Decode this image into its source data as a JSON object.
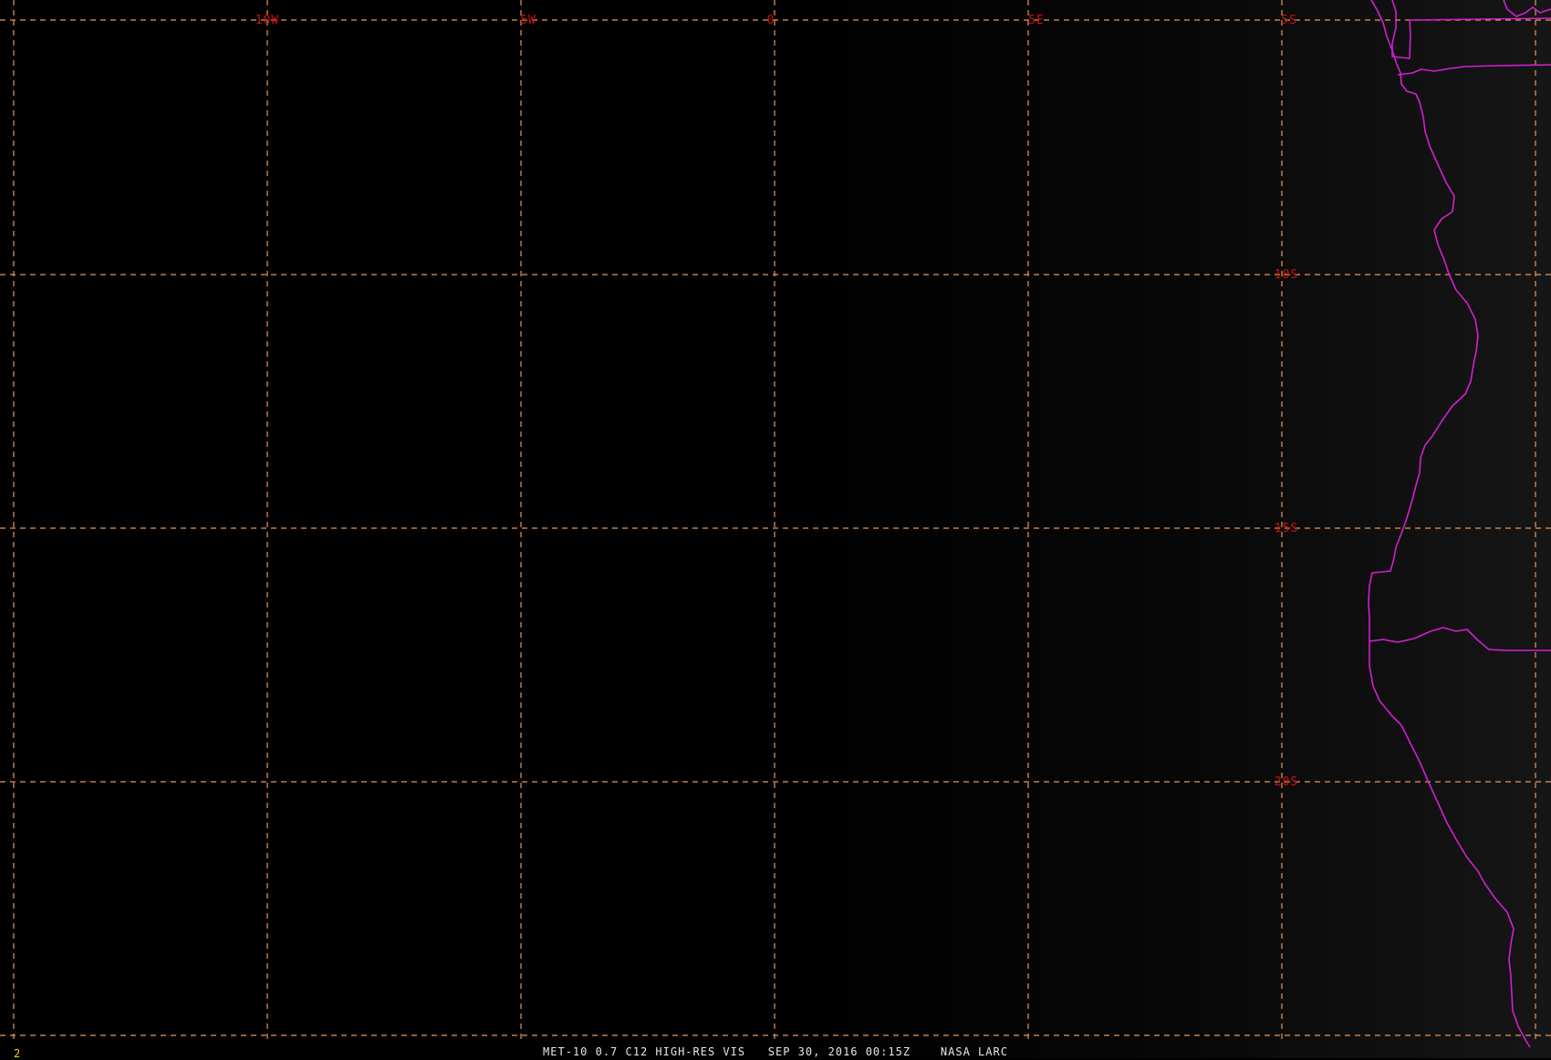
{
  "map": {
    "background_color": "#000000",
    "gridline_color": "#e8965a",
    "label_color": "#cc1111",
    "coastline_color": "#d21fd2",
    "lon_labels": [
      "10W",
      "5W",
      "0",
      "5E"
    ],
    "lat_labels": [
      "5S",
      "10S",
      "15S",
      "20S"
    ]
  },
  "footer": {
    "frame_number": "2",
    "caption": "MET-10 0.7 C12 HIGH-RES VIS   SEP 30, 2016 00:15Z    NASA LARC"
  }
}
